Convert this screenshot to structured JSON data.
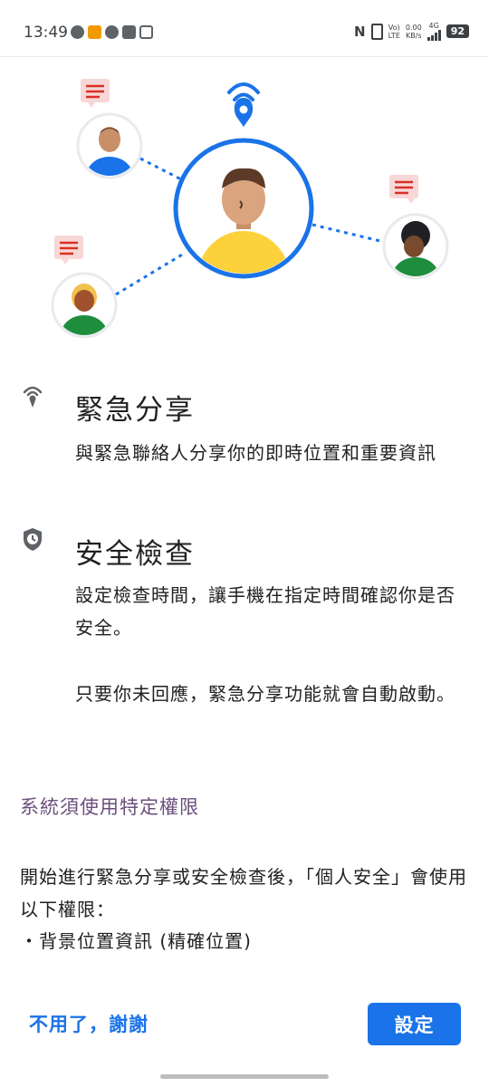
{
  "status_bar": {
    "time": "13:49",
    "net_top": "0.00",
    "net_bottom": "KB/s",
    "volte_top": "Vo)",
    "volte_bottom": "LTE",
    "signal_label": "4G",
    "battery": "92"
  },
  "sections": [
    {
      "icon": "location-signal-icon",
      "title": "緊急分享",
      "body": "與緊急聯絡人分享你的即時位置和重要資訊"
    },
    {
      "icon": "shield-clock-icon",
      "title": "安全檢查",
      "body": "設定檢查時間，讓手機在指定時間確認你是否安全。",
      "body2": "只要你未回應，緊急分享功能就會自動啟動。"
    }
  ],
  "permissions": {
    "title": "系統須使用特定權限",
    "body": "開始進行緊急分享或安全檢查後，「個人安全」會使用以下權限：",
    "item": "・背景位置資訊 (精確位置)"
  },
  "buttons": {
    "decline": "不用了，謝謝",
    "confirm": "設定"
  },
  "colors": {
    "accent": "#1a73e8",
    "permission_heading": "#6b4f7c",
    "chat_bubble": "#f8d7d7",
    "avatar_yellow": "#fdd13b",
    "avatar_green": "#1e8e3e"
  }
}
